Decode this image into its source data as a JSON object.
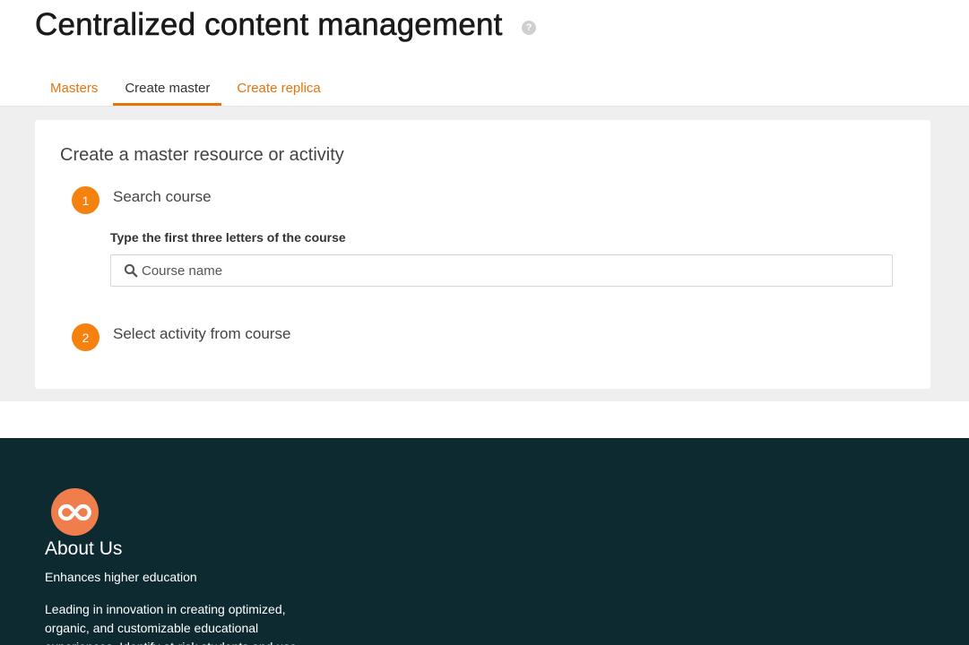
{
  "header": {
    "title": "Centralized content management",
    "help_icon": "question-circle-icon",
    "help_symbol": "?"
  },
  "tabs": [
    {
      "label": "Masters",
      "active": false
    },
    {
      "label": "Create master",
      "active": true
    },
    {
      "label": "Create replica",
      "active": false
    }
  ],
  "main": {
    "title": "Create a master resource or activity",
    "steps": [
      {
        "number": "1",
        "title": "Search course",
        "field_label": "Type the first three letters of the course",
        "search_placeholder": "Course name",
        "search_value": ""
      },
      {
        "number": "2",
        "title": "Select activity from course"
      }
    ]
  },
  "footer": {
    "logo_icon": "infinity-logo-icon",
    "heading": "About Us",
    "tagline": "Enhances higher education",
    "description": "Leading in innovation in creating optimized, organic, and customizable educational experiences. Identify at-risk students and use"
  },
  "colors": {
    "accent": "#e8730c",
    "step_badge": "#f5820f",
    "footer_bg": "#0e2a31",
    "logo": "#f07e4d",
    "main_bg": "#efefef"
  }
}
